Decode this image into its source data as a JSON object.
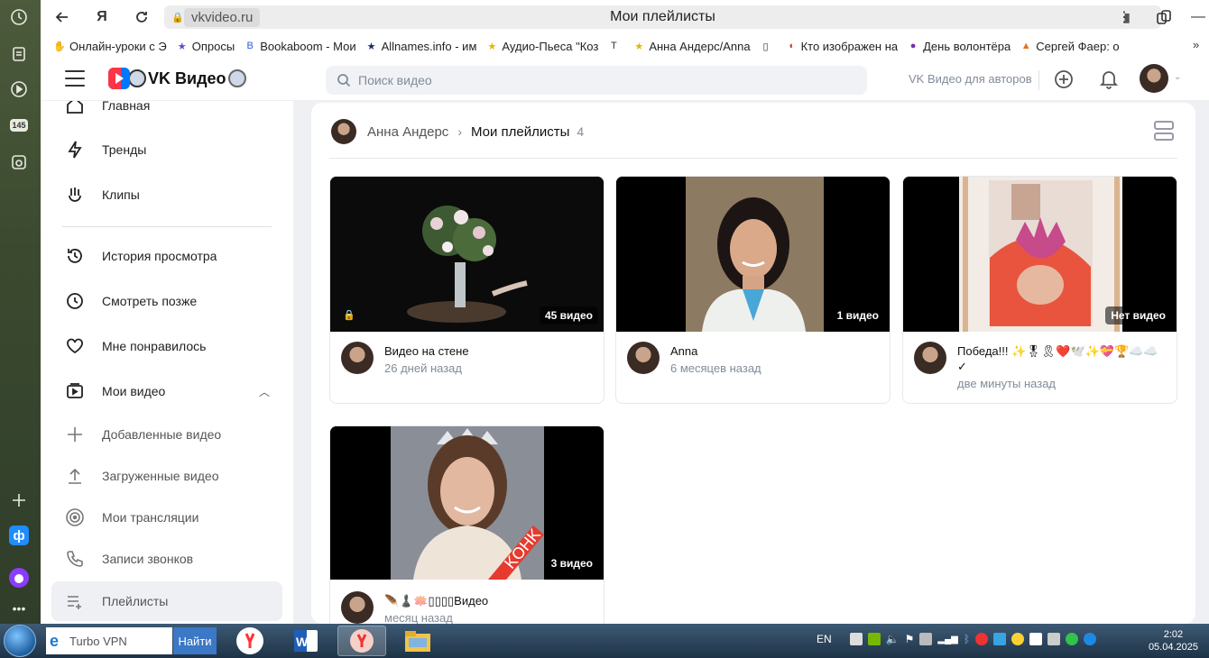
{
  "browser": {
    "domain": "vkvideo.ru",
    "page_title": "Мои плейлисты",
    "rail_badge": "145",
    "bookmarks": [
      {
        "label": "Онлайн-уроки с Э",
        "icon": "hand-icon",
        "color": "#555555"
      },
      {
        "label": "Опросы",
        "icon": "star-icon",
        "color": "#5b4cdb"
      },
      {
        "label": "Bookaboom - Мои",
        "icon": "book-icon",
        "color": "#2b5fd9"
      },
      {
        "label": "Allnames.info - им",
        "icon": "star-icon",
        "color": "#1b2a6b"
      },
      {
        "label": "Аудио-Пьеса \"Коз",
        "icon": "star-icon",
        "color": "#e8b400"
      },
      {
        "label": "",
        "icon": "t-icon",
        "color": "#333333"
      },
      {
        "label": "Анна Андерс/Anna",
        "icon": "star-icon",
        "color": "#e8b400"
      },
      {
        "label": "",
        "icon": "doc-icon",
        "color": "#333333"
      },
      {
        "label": "Кто изображен на",
        "icon": "audio-icon",
        "color": "#d33"
      },
      {
        "label": "День волонтёра",
        "icon": "cat-icon",
        "color": "#7b2bb0"
      },
      {
        "label": "Сергей Фаер: о",
        "icon": "fire-icon",
        "color": "#e8711a"
      }
    ]
  },
  "header": {
    "logo_text": "VK Видео",
    "search_placeholder": "Поиск видео",
    "authors_link": "VK Видео для авторов"
  },
  "sidebar": {
    "items": [
      {
        "label": "Главная",
        "icon": "home-icon"
      },
      {
        "label": "Тренды",
        "icon": "lightning-icon"
      },
      {
        "label": "Клипы",
        "icon": "clips-icon"
      },
      {
        "label": "История просмотра",
        "icon": "history-icon"
      },
      {
        "label": "Смотреть позже",
        "icon": "clock-icon"
      },
      {
        "label": "Мне понравилось",
        "icon": "heart-icon"
      },
      {
        "label": "Мои видео",
        "icon": "video-icon"
      }
    ],
    "subitems": [
      {
        "label": "Добавленные видео",
        "icon": "plus-icon"
      },
      {
        "label": "Загруженные видео",
        "icon": "upload-icon"
      },
      {
        "label": "Мои трансляции",
        "icon": "broadcast-icon"
      },
      {
        "label": "Записи звонков",
        "icon": "phone-icon"
      },
      {
        "label": "Плейлисты",
        "icon": "playlist-icon"
      }
    ]
  },
  "breadcrumb": {
    "owner": "Анна Андерс",
    "current": "Мои плейлисты",
    "count": "4"
  },
  "playlists": [
    {
      "title": "Видео на стене",
      "date": "26 дней назад",
      "count": "45 видео",
      "locked": true
    },
    {
      "title": "Anna",
      "date": "6 месяцев назад",
      "count": "1 видео",
      "locked": false
    },
    {
      "title": "Победа!!! ✨🎖🎗❤️🕊️✨💝🏆☁️☁️✓",
      "date": "две минуты назад",
      "count": "Нет видео",
      "locked": false
    },
    {
      "title": "🪶♟️🪷▯▯▯▯Видео",
      "date": "месяц назад",
      "count": "3 видео",
      "locked": false
    }
  ],
  "taskbar": {
    "search_value": "Turbo VPN",
    "find_label": "Найти",
    "lang": "EN",
    "time": "2:02",
    "date": "05.04.2025"
  },
  "colors": {
    "accent": "#0077ff",
    "vk_red": "#ff3347",
    "page_bg": "#eef0f3",
    "muted_text": "#818c99"
  }
}
